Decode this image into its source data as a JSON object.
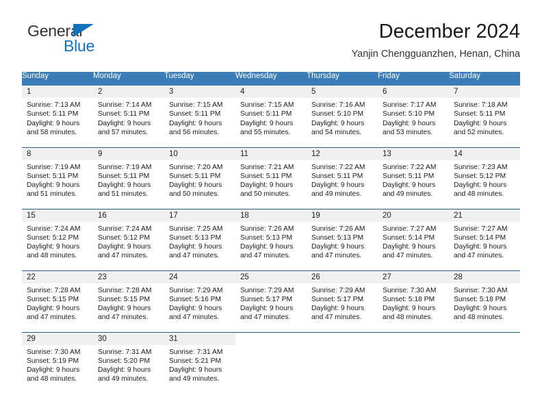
{
  "brand": {
    "name_part1": "General",
    "name_part2": "Blue",
    "triangle_icon": "blue-triangle-logo-mark",
    "color_dark": "#333333",
    "color_blue": "#1271bb"
  },
  "header": {
    "title": "December 2024",
    "subtitle": "Yanjin Chengguanzhen, Henan, China"
  },
  "theme": {
    "header_blue": "#3a7cb8",
    "row_separator": "#2e5f8a",
    "daynum_band": "#f0f0f0",
    "text": "#1a1a1a"
  },
  "weekdays": [
    "Sunday",
    "Monday",
    "Tuesday",
    "Wednesday",
    "Thursday",
    "Friday",
    "Saturday"
  ],
  "weeks": [
    [
      {
        "day": "1",
        "sunrise": "Sunrise: 7:13 AM",
        "sunset": "Sunset: 5:11 PM",
        "daylight_line1": "Daylight: 9 hours",
        "daylight_line2": "and 58 minutes."
      },
      {
        "day": "2",
        "sunrise": "Sunrise: 7:14 AM",
        "sunset": "Sunset: 5:11 PM",
        "daylight_line1": "Daylight: 9 hours",
        "daylight_line2": "and 57 minutes."
      },
      {
        "day": "3",
        "sunrise": "Sunrise: 7:15 AM",
        "sunset": "Sunset: 5:11 PM",
        "daylight_line1": "Daylight: 9 hours",
        "daylight_line2": "and 56 minutes."
      },
      {
        "day": "4",
        "sunrise": "Sunrise: 7:15 AM",
        "sunset": "Sunset: 5:11 PM",
        "daylight_line1": "Daylight: 9 hours",
        "daylight_line2": "and 55 minutes."
      },
      {
        "day": "5",
        "sunrise": "Sunrise: 7:16 AM",
        "sunset": "Sunset: 5:10 PM",
        "daylight_line1": "Daylight: 9 hours",
        "daylight_line2": "and 54 minutes."
      },
      {
        "day": "6",
        "sunrise": "Sunrise: 7:17 AM",
        "sunset": "Sunset: 5:10 PM",
        "daylight_line1": "Daylight: 9 hours",
        "daylight_line2": "and 53 minutes."
      },
      {
        "day": "7",
        "sunrise": "Sunrise: 7:18 AM",
        "sunset": "Sunset: 5:11 PM",
        "daylight_line1": "Daylight: 9 hours",
        "daylight_line2": "and 52 minutes."
      }
    ],
    [
      {
        "day": "8",
        "sunrise": "Sunrise: 7:19 AM",
        "sunset": "Sunset: 5:11 PM",
        "daylight_line1": "Daylight: 9 hours",
        "daylight_line2": "and 51 minutes."
      },
      {
        "day": "9",
        "sunrise": "Sunrise: 7:19 AM",
        "sunset": "Sunset: 5:11 PM",
        "daylight_line1": "Daylight: 9 hours",
        "daylight_line2": "and 51 minutes."
      },
      {
        "day": "10",
        "sunrise": "Sunrise: 7:20 AM",
        "sunset": "Sunset: 5:11 PM",
        "daylight_line1": "Daylight: 9 hours",
        "daylight_line2": "and 50 minutes."
      },
      {
        "day": "11",
        "sunrise": "Sunrise: 7:21 AM",
        "sunset": "Sunset: 5:11 PM",
        "daylight_line1": "Daylight: 9 hours",
        "daylight_line2": "and 50 minutes."
      },
      {
        "day": "12",
        "sunrise": "Sunrise: 7:22 AM",
        "sunset": "Sunset: 5:11 PM",
        "daylight_line1": "Daylight: 9 hours",
        "daylight_line2": "and 49 minutes."
      },
      {
        "day": "13",
        "sunrise": "Sunrise: 7:22 AM",
        "sunset": "Sunset: 5:11 PM",
        "daylight_line1": "Daylight: 9 hours",
        "daylight_line2": "and 49 minutes."
      },
      {
        "day": "14",
        "sunrise": "Sunrise: 7:23 AM",
        "sunset": "Sunset: 5:12 PM",
        "daylight_line1": "Daylight: 9 hours",
        "daylight_line2": "and 48 minutes."
      }
    ],
    [
      {
        "day": "15",
        "sunrise": "Sunrise: 7:24 AM",
        "sunset": "Sunset: 5:12 PM",
        "daylight_line1": "Daylight: 9 hours",
        "daylight_line2": "and 48 minutes."
      },
      {
        "day": "16",
        "sunrise": "Sunrise: 7:24 AM",
        "sunset": "Sunset: 5:12 PM",
        "daylight_line1": "Daylight: 9 hours",
        "daylight_line2": "and 47 minutes."
      },
      {
        "day": "17",
        "sunrise": "Sunrise: 7:25 AM",
        "sunset": "Sunset: 5:13 PM",
        "daylight_line1": "Daylight: 9 hours",
        "daylight_line2": "and 47 minutes."
      },
      {
        "day": "18",
        "sunrise": "Sunrise: 7:26 AM",
        "sunset": "Sunset: 5:13 PM",
        "daylight_line1": "Daylight: 9 hours",
        "daylight_line2": "and 47 minutes."
      },
      {
        "day": "19",
        "sunrise": "Sunrise: 7:26 AM",
        "sunset": "Sunset: 5:13 PM",
        "daylight_line1": "Daylight: 9 hours",
        "daylight_line2": "and 47 minutes."
      },
      {
        "day": "20",
        "sunrise": "Sunrise: 7:27 AM",
        "sunset": "Sunset: 5:14 PM",
        "daylight_line1": "Daylight: 9 hours",
        "daylight_line2": "and 47 minutes."
      },
      {
        "day": "21",
        "sunrise": "Sunrise: 7:27 AM",
        "sunset": "Sunset: 5:14 PM",
        "daylight_line1": "Daylight: 9 hours",
        "daylight_line2": "and 47 minutes."
      }
    ],
    [
      {
        "day": "22",
        "sunrise": "Sunrise: 7:28 AM",
        "sunset": "Sunset: 5:15 PM",
        "daylight_line1": "Daylight: 9 hours",
        "daylight_line2": "and 47 minutes."
      },
      {
        "day": "23",
        "sunrise": "Sunrise: 7:28 AM",
        "sunset": "Sunset: 5:15 PM",
        "daylight_line1": "Daylight: 9 hours",
        "daylight_line2": "and 47 minutes."
      },
      {
        "day": "24",
        "sunrise": "Sunrise: 7:29 AM",
        "sunset": "Sunset: 5:16 PM",
        "daylight_line1": "Daylight: 9 hours",
        "daylight_line2": "and 47 minutes."
      },
      {
        "day": "25",
        "sunrise": "Sunrise: 7:29 AM",
        "sunset": "Sunset: 5:17 PM",
        "daylight_line1": "Daylight: 9 hours",
        "daylight_line2": "and 47 minutes."
      },
      {
        "day": "26",
        "sunrise": "Sunrise: 7:29 AM",
        "sunset": "Sunset: 5:17 PM",
        "daylight_line1": "Daylight: 9 hours",
        "daylight_line2": "and 47 minutes."
      },
      {
        "day": "27",
        "sunrise": "Sunrise: 7:30 AM",
        "sunset": "Sunset: 5:18 PM",
        "daylight_line1": "Daylight: 9 hours",
        "daylight_line2": "and 48 minutes."
      },
      {
        "day": "28",
        "sunrise": "Sunrise: 7:30 AM",
        "sunset": "Sunset: 5:18 PM",
        "daylight_line1": "Daylight: 9 hours",
        "daylight_line2": "and 48 minutes."
      }
    ],
    [
      {
        "day": "29",
        "sunrise": "Sunrise: 7:30 AM",
        "sunset": "Sunset: 5:19 PM",
        "daylight_line1": "Daylight: 9 hours",
        "daylight_line2": "and 48 minutes."
      },
      {
        "day": "30",
        "sunrise": "Sunrise: 7:31 AM",
        "sunset": "Sunset: 5:20 PM",
        "daylight_line1": "Daylight: 9 hours",
        "daylight_line2": "and 49 minutes."
      },
      {
        "day": "31",
        "sunrise": "Sunrise: 7:31 AM",
        "sunset": "Sunset: 5:21 PM",
        "daylight_line1": "Daylight: 9 hours",
        "daylight_line2": "and 49 minutes."
      },
      {
        "day": "",
        "sunrise": "",
        "sunset": "",
        "daylight_line1": "",
        "daylight_line2": ""
      },
      {
        "day": "",
        "sunrise": "",
        "sunset": "",
        "daylight_line1": "",
        "daylight_line2": ""
      },
      {
        "day": "",
        "sunrise": "",
        "sunset": "",
        "daylight_line1": "",
        "daylight_line2": ""
      },
      {
        "day": "",
        "sunrise": "",
        "sunset": "",
        "daylight_line1": "",
        "daylight_line2": ""
      }
    ]
  ]
}
